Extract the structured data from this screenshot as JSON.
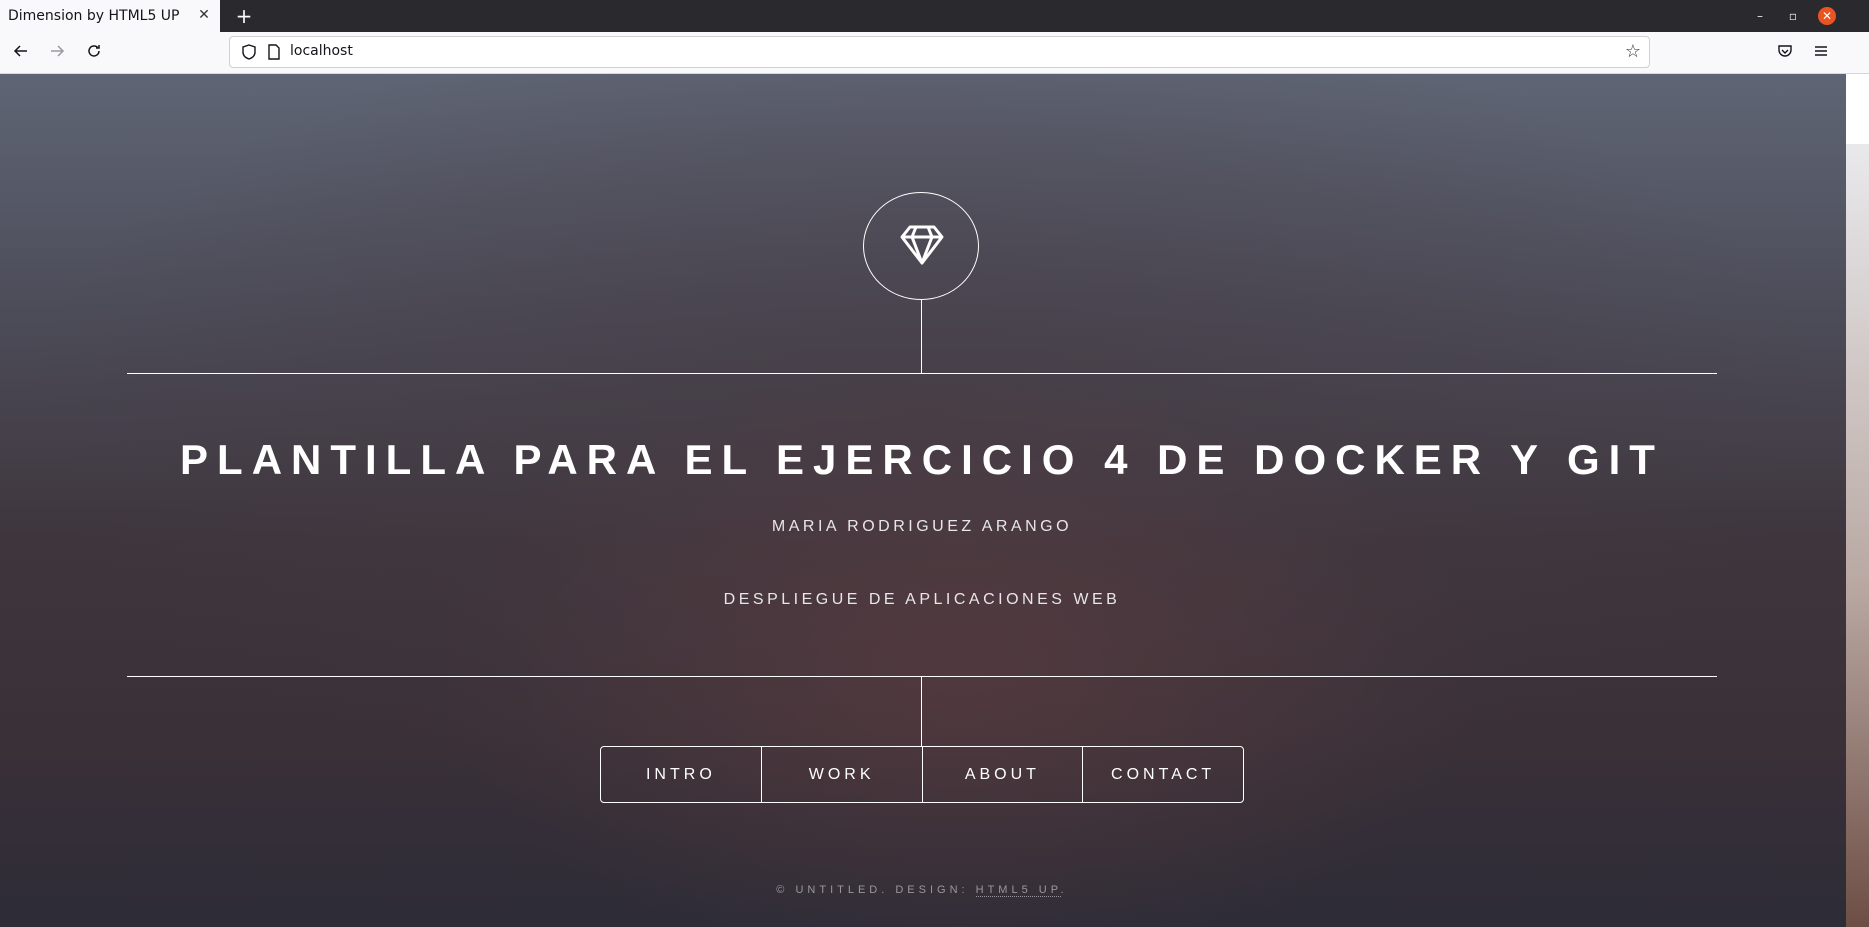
{
  "browser": {
    "tab_title": "Dimension by HTML5 UP",
    "tab_close": "✕",
    "new_tab": "+",
    "url": "localhost",
    "controls": {
      "minimize": "–",
      "restore": "▫",
      "close": "✕"
    }
  },
  "page": {
    "title": "PLANTILLA PARA EL EJERCICIO 4 DE DOCKER Y GIT",
    "author": "MARIA RODRIGUEZ ARANGO",
    "subject": "DESPLIEGUE DE APLICACIONES WEB",
    "nav": [
      {
        "label": "INTRO"
      },
      {
        "label": "WORK"
      },
      {
        "label": "ABOUT"
      },
      {
        "label": "CONTACT"
      }
    ],
    "footer": {
      "prefix": "© UNTITLED. DESIGN: ",
      "link": "HTML5 UP",
      "suffix": "."
    }
  },
  "colors": {
    "accent_close": "#e95420",
    "text": "#ffffff"
  },
  "icons": [
    "back-arrow-icon",
    "forward-arrow-icon",
    "reload-icon",
    "shield-icon",
    "page-icon",
    "star-icon",
    "pocket-icon",
    "menu-icon",
    "diamond-icon"
  ]
}
